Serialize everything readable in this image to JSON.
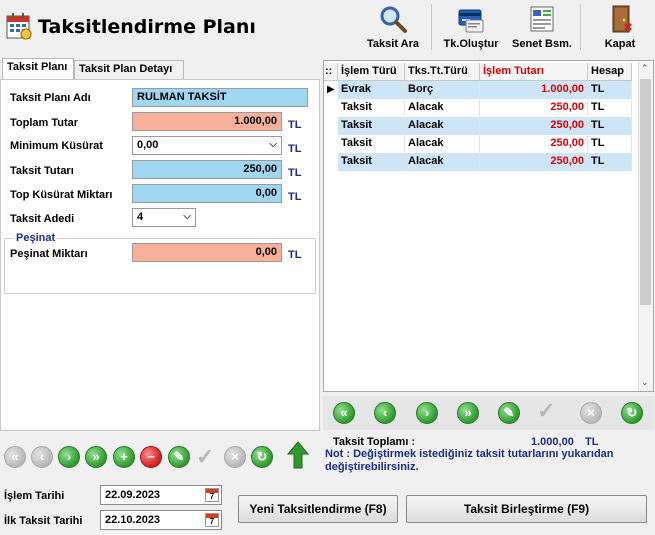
{
  "window": {
    "title": "Taksitlendirme Planı"
  },
  "toolbar": {
    "items": [
      {
        "label": "Taksit Ara",
        "icon": "magnifier-icon"
      },
      {
        "label": "Tk.Oluştur",
        "icon": "card-create-icon"
      },
      {
        "label": "Senet Bsm.",
        "icon": "print-note-icon"
      },
      {
        "label": "Kapat",
        "icon": "exit-door-icon"
      }
    ]
  },
  "tabs": [
    {
      "label": "Taksit Planı",
      "active": true
    },
    {
      "label": "Taksit Plan Detayı",
      "active": false
    }
  ],
  "form": {
    "plan_name_label": "Taksit Planı Adı",
    "plan_name_value": "RULMAN TAKSİT",
    "total_label": "Toplam Tutar",
    "total_value": "1.000,00",
    "total_unit": "TL",
    "min_fraction_label": "Minimum Küsürat",
    "min_fraction_value": "0,00",
    "min_fraction_unit": "TL",
    "installment_amount_label": "Taksit Tutarı",
    "installment_amount_value": "250,00",
    "installment_amount_unit": "TL",
    "top_fraction_label": "Top Küsürat Miktarı",
    "top_fraction_value": "0,00",
    "top_fraction_unit": "TL",
    "count_label": "Taksit Adedi",
    "count_value": "4",
    "downpayment_group": "Peşinat",
    "downpayment_label": "Peşinat Miktarı",
    "downpayment_value": "0,00",
    "downpayment_unit": "TL"
  },
  "grid": {
    "columns": [
      "İşlem Türü",
      "Tks.Tt.Türü",
      "İşlem Tutarı",
      "Hesap"
    ],
    "marker": "::",
    "rows": [
      {
        "islem": "Evrak",
        "tur": "Borç",
        "tutar": "1.000,00",
        "hesap": "TL"
      },
      {
        "islem": "Taksit",
        "tur": "Alacak",
        "tutar": "250,00",
        "hesap": "TL"
      },
      {
        "islem": "Taksit",
        "tur": "Alacak",
        "tutar": "250,00",
        "hesap": "TL"
      },
      {
        "islem": "Taksit",
        "tur": "Alacak",
        "tutar": "250,00",
        "hesap": "TL"
      },
      {
        "islem": "Taksit",
        "tur": "Alacak",
        "tutar": "250,00",
        "hesap": "TL"
      }
    ]
  },
  "summary": {
    "label": "Taksit Toplamı :",
    "value": "1.000,00",
    "unit": "TL",
    "note": "Not : Değiştirmek istediğiniz taksit tutarlarını yukarıdan değiştirebilirsiniz."
  },
  "bottom": {
    "islem_tarihi_label": "İşlem Tarihi",
    "islem_tarihi_value": "22.09.2023",
    "ilk_taksit_label": "İlk Taksit Tarihi",
    "ilk_taksit_value": "22.10.2023",
    "calendar_day": "7",
    "new_button": "Yeni Taksitlendirme (F8)",
    "merge_button": "Taksit Birleştirme (F9)"
  },
  "colors": {
    "blue_field": "#9fd7f3",
    "salmon_field": "#f7b19a",
    "amount_red": "#e00000",
    "unit_navy": "#1a2c8a"
  }
}
